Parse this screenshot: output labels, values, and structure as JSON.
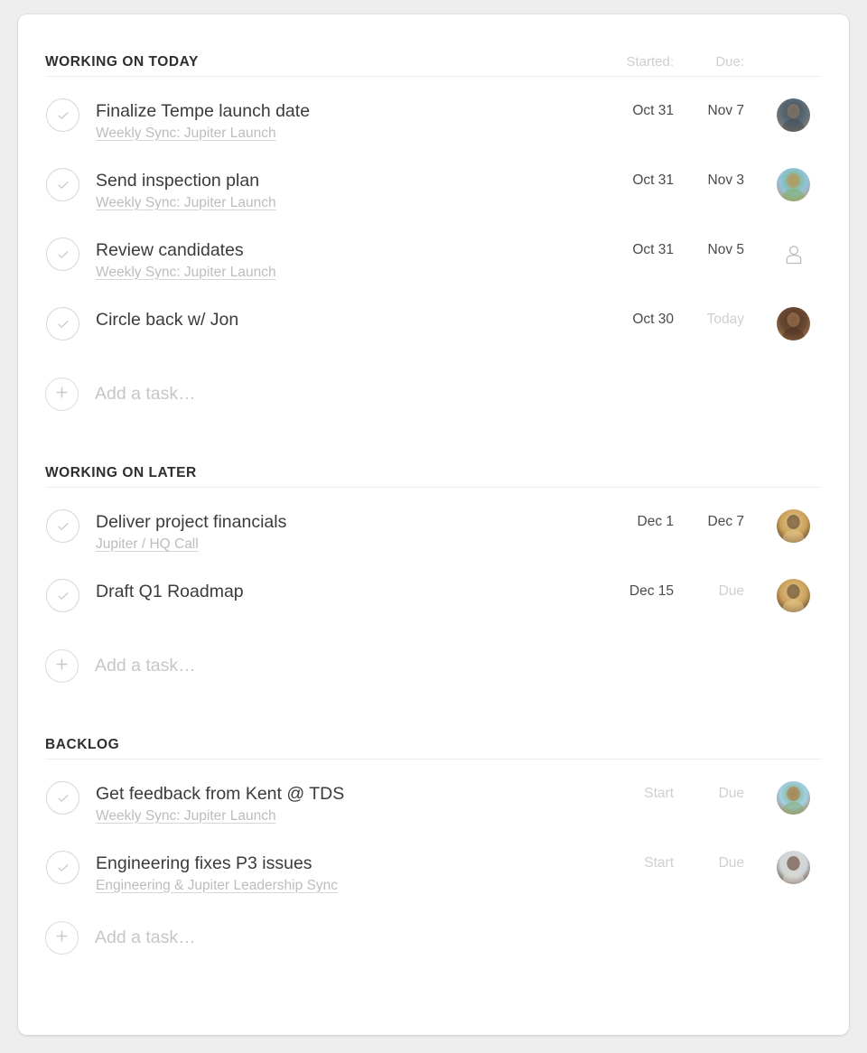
{
  "columns": {
    "started_label": "Started:",
    "due_label": "Due:"
  },
  "add_task_label": "Add a task…",
  "icons": {
    "check": "check-icon",
    "plus": "plus-icon",
    "person_placeholder": "person-placeholder-icon"
  },
  "sections": [
    {
      "title": "WORKING ON TODAY",
      "show_column_headers": true,
      "tasks": [
        {
          "title": "Finalize Tempe launch date",
          "subtitle": "Weekly Sync: Jupiter Launch",
          "started": "Oct 31",
          "started_placeholder": false,
          "due": "Nov 7",
          "due_placeholder": false,
          "avatar": {
            "type": "photo",
            "colors": [
              "#5d6d78",
              "#9c8269",
              "#3f4a52"
            ]
          }
        },
        {
          "title": "Send inspection plan",
          "subtitle": "Weekly Sync: Jupiter Launch",
          "started": "Oct 31",
          "started_placeholder": false,
          "due": "Nov 3",
          "due_placeholder": false,
          "avatar": {
            "type": "photo",
            "colors": [
              "#8fc4e0",
              "#c98f5e",
              "#7fae54"
            ]
          }
        },
        {
          "title": "Review candidates",
          "subtitle": "Weekly Sync: Jupiter Launch",
          "started": "Oct 31",
          "started_placeholder": false,
          "due": "Nov 5",
          "due_placeholder": false,
          "avatar": {
            "type": "placeholder",
            "colors": []
          }
        },
        {
          "title": "Circle back w/ Jon",
          "subtitle": "",
          "started": "Oct 30",
          "started_placeholder": false,
          "due": "Today",
          "due_placeholder": true,
          "avatar": {
            "type": "photo",
            "colors": [
              "#6b4a33",
              "#b08257",
              "#4a3220"
            ]
          }
        }
      ]
    },
    {
      "title": "WORKING ON LATER",
      "show_column_headers": false,
      "tasks": [
        {
          "title": "Deliver project financials",
          "subtitle": "Jupiter / HQ Call",
          "started": "Dec 1",
          "started_placeholder": false,
          "due": "Dec 7",
          "due_placeholder": false,
          "avatar": {
            "type": "photo",
            "colors": [
              "#c9a05a",
              "#4a3526",
              "#e7c98d"
            ]
          }
        },
        {
          "title": "Draft Q1 Roadmap",
          "subtitle": "",
          "started": "Dec 15",
          "started_placeholder": false,
          "due": "Due",
          "due_placeholder": true,
          "avatar": {
            "type": "photo",
            "colors": [
              "#c9a05a",
              "#4a3526",
              "#e7c98d"
            ]
          }
        }
      ]
    },
    {
      "title": "BACKLOG",
      "show_column_headers": false,
      "tasks": [
        {
          "title": "Get feedback from Kent @ TDS",
          "subtitle": "Weekly Sync: Jupiter Launch",
          "started": "Start",
          "started_placeholder": true,
          "due": "Due",
          "due_placeholder": true,
          "avatar": {
            "type": "photo",
            "colors": [
              "#9fd2e8",
              "#b9713e",
              "#88a86a"
            ]
          }
        },
        {
          "title": "Engineering fixes P3 issues",
          "subtitle": "Engineering & Jupiter Leadership Sync",
          "started": "Start",
          "started_placeholder": true,
          "due": "Due",
          "due_placeholder": true,
          "avatar": {
            "type": "photo",
            "colors": [
              "#cfd5d8",
              "#50301f",
              "#ded9d2"
            ]
          }
        }
      ]
    }
  ]
}
